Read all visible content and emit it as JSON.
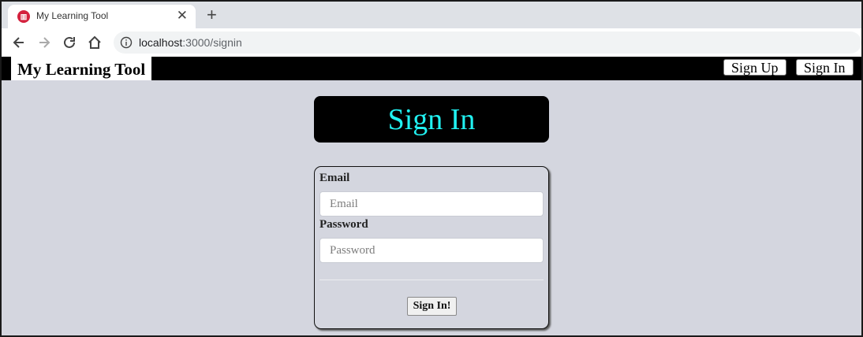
{
  "browser": {
    "tab_title": "My Learning Tool",
    "close_glyph": "✕",
    "new_tab_glyph": "+",
    "url_host": "localhost",
    "url_path": ":3000/signin"
  },
  "header": {
    "brand": "My Learning Tool",
    "signup_label": "Sign Up",
    "signin_label": "Sign In"
  },
  "page": {
    "heading": "Sign In",
    "heading_color": "#21f1f1"
  },
  "form": {
    "email_label": "Email",
    "email_placeholder": "Email",
    "email_value": "",
    "password_label": "Password",
    "password_placeholder": "Password",
    "password_value": "",
    "submit_label": "Sign In!"
  }
}
